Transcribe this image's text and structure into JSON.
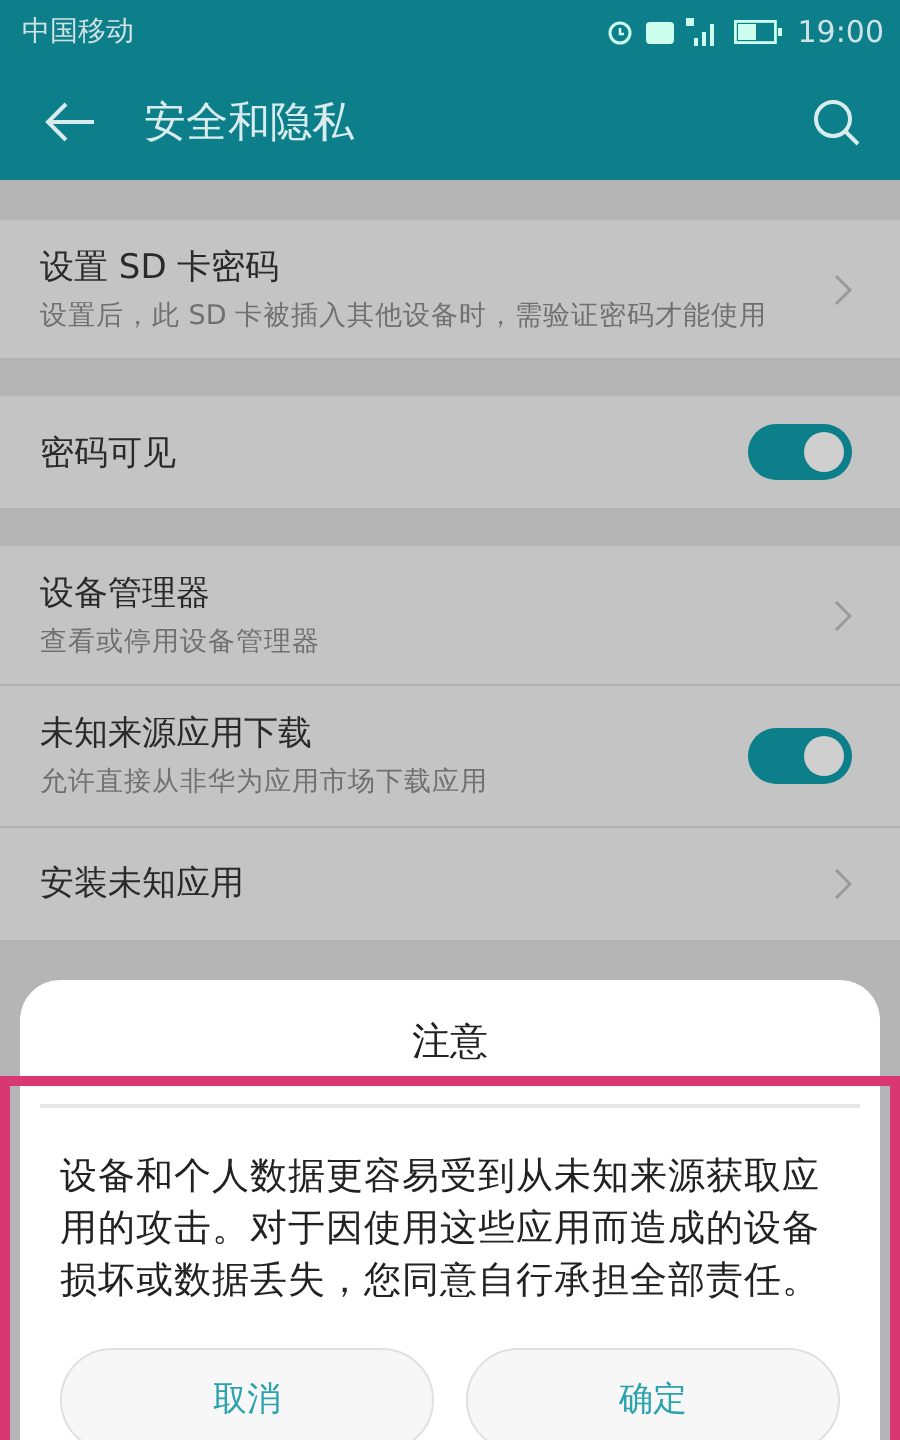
{
  "status_bar": {
    "carrier": "中国移动",
    "time": "19:00"
  },
  "toolbar": {
    "title": "安全和隐私"
  },
  "sections": [
    [
      {
        "kind": "link",
        "title": "设置 SD 卡密码",
        "subtitle": "设置后，此 SD 卡被插入其他设备时，需验证密码才能使用"
      }
    ],
    [
      {
        "kind": "switch",
        "title": "密码可见",
        "on": true
      }
    ],
    [
      {
        "kind": "link",
        "title": "设备管理器",
        "subtitle": "查看或停用设备管理器"
      },
      {
        "kind": "switch",
        "title": "未知来源应用下载",
        "subtitle": "允许直接从非华为应用市场下载应用",
        "on": true
      },
      {
        "kind": "link",
        "title": "安装未知应用"
      }
    ]
  ],
  "dialog": {
    "title": "注意",
    "message": "设备和个人数据更容易受到从未知来源获取应用的攻击。对于因使用这些应用而造成的设备损坏或数据丢失，您同意自行承担全部责任。",
    "buttons": [
      "取消",
      "确定"
    ]
  }
}
